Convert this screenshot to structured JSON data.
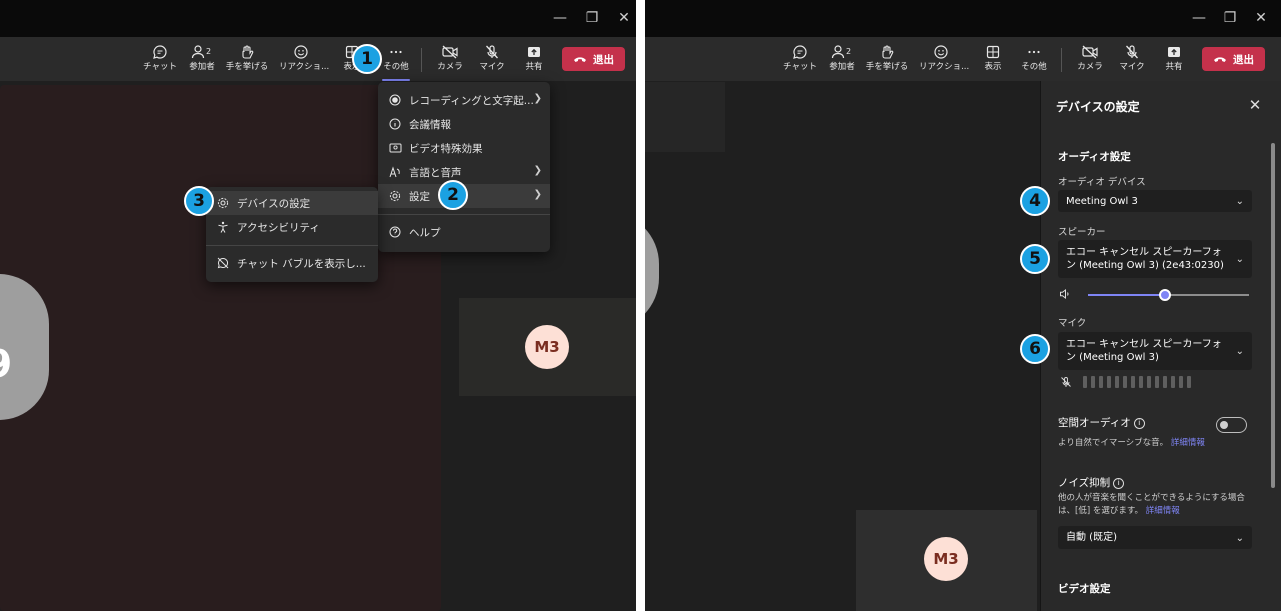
{
  "toolbar": {
    "chat": "チャット",
    "participants": "参加者",
    "participants_count": "2",
    "raise_hand": "手を挙げる",
    "reactions": "リアクショ...",
    "view": "表示",
    "more": "その他",
    "camera": "カメラ",
    "mic": "マイク",
    "share": "共有",
    "leave": "退出"
  },
  "more_menu": {
    "items": [
      {
        "label": "レコーディングと文字起...",
        "icon": "record-icon",
        "submenu": true
      },
      {
        "label": "会議情報",
        "icon": "info-icon",
        "submenu": false
      },
      {
        "label": "ビデオ特殊効果",
        "icon": "video-effects-icon",
        "submenu": false
      },
      {
        "label": "言語と音声",
        "icon": "language-icon",
        "submenu": true
      },
      {
        "label": "設定",
        "icon": "gear-icon",
        "submenu": true
      },
      {
        "label": "ヘルプ",
        "icon": "help-icon",
        "submenu": false
      }
    ]
  },
  "settings_submenu": {
    "items": [
      {
        "label": "デバイスの設定",
        "icon": "gear-icon"
      },
      {
        "label": "アクセシビリティ",
        "icon": "accessibility-icon"
      },
      {
        "label": "チャット バブルを表示し...",
        "icon": "chat-bubble-off-icon"
      }
    ]
  },
  "badges": [
    "1",
    "2",
    "3",
    "4",
    "5",
    "6"
  ],
  "participant": {
    "initials": "M3",
    "big_avatar_char": "9"
  },
  "device_settings": {
    "title": "デバイスの設定",
    "audio_header": "オーディオ設定",
    "audio_device_label": "オーディオ デバイス",
    "audio_device_value": "Meeting Owl 3",
    "speaker_label": "スピーカー",
    "speaker_value": "エコー キャンセル スピーカーフォン (Meeting Owl 3) (2e43:0230)",
    "speaker_volume": 0.48,
    "mic_label": "マイク",
    "mic_value": "エコー キャンセル スピーカーフォン (Meeting Owl 3)",
    "spatial_audio_label": "空間オーディオ",
    "spatial_audio_on": false,
    "spatial_audio_desc": "より自然でイマーシブな音。",
    "learn_more": "詳細情報",
    "noise_label": "ノイズ抑制",
    "noise_desc": "他の人が音楽を聞くことができるようにする場合は、[低] を選びます。",
    "noise_value": "自動 (既定)",
    "video_header": "ビデオ設定"
  },
  "colors": {
    "accent": "#7f85f5",
    "leave": "#c4314b",
    "badge": "#1ba1e2",
    "avatar_bg": "#fde0d6",
    "avatar_fg": "#7a2d20"
  }
}
